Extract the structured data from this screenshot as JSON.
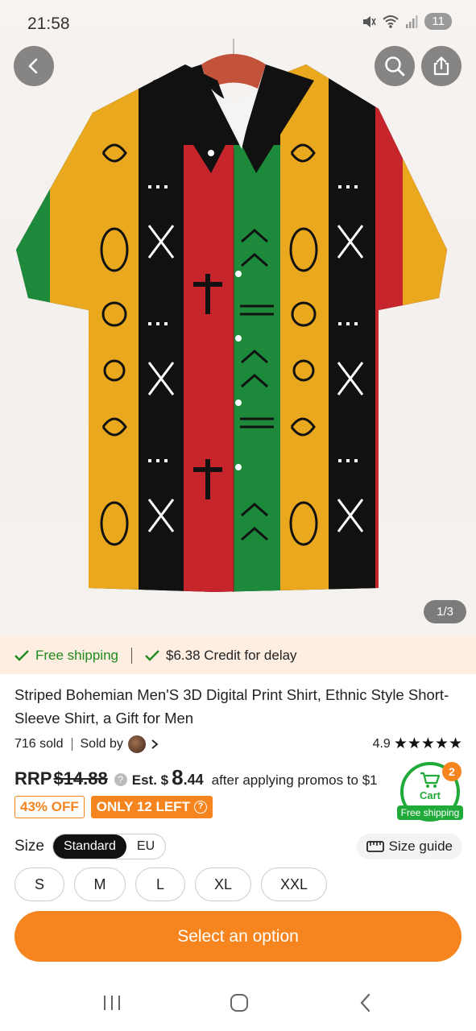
{
  "status_bar": {
    "time": "21:58",
    "battery": "11"
  },
  "gallery": {
    "counter": "1/3"
  },
  "shipping_bar": {
    "free_shipping": "Free shipping",
    "credit": "$6.38 Credit for delay"
  },
  "product": {
    "title": "Striped Bohemian Men'S 3D Digital Print Shirt, Ethnic Style Short-Sleeve Shirt, a Gift for Men",
    "sold": "716 sold",
    "sold_by": "Sold by",
    "rating": "4.9",
    "stars": "★★★★★"
  },
  "price": {
    "rrp_label": "RRP",
    "rrp_value": "$14.88",
    "est_label": "Est. $",
    "est_whole": "8",
    "est_cents": ".44",
    "after_text": "after applying promos to $1"
  },
  "badges": {
    "discount": "43% OFF",
    "stock": "ONLY 12 LEFT"
  },
  "cart": {
    "count": "2",
    "label": "Cart",
    "free_shipping": "Free shipping"
  },
  "size_selector": {
    "label": "Size",
    "standards": [
      "Standard",
      "EU"
    ],
    "selected_standard": "Standard",
    "size_guide": "Size guide",
    "options": [
      "S",
      "M",
      "L",
      "XL",
      "XXL"
    ]
  },
  "cta": {
    "label": "Select an option"
  },
  "colors": {
    "accent": "#f6841f",
    "green": "#1faa3a",
    "shipbar_bg": "#fdeee1"
  },
  "icons": [
    "back-arrow-icon",
    "search-icon",
    "share-icon",
    "check-icon",
    "chevron-right-icon",
    "cart-icon",
    "ruler-icon",
    "nav-recents-icon",
    "nav-home-icon",
    "nav-back-icon"
  ]
}
